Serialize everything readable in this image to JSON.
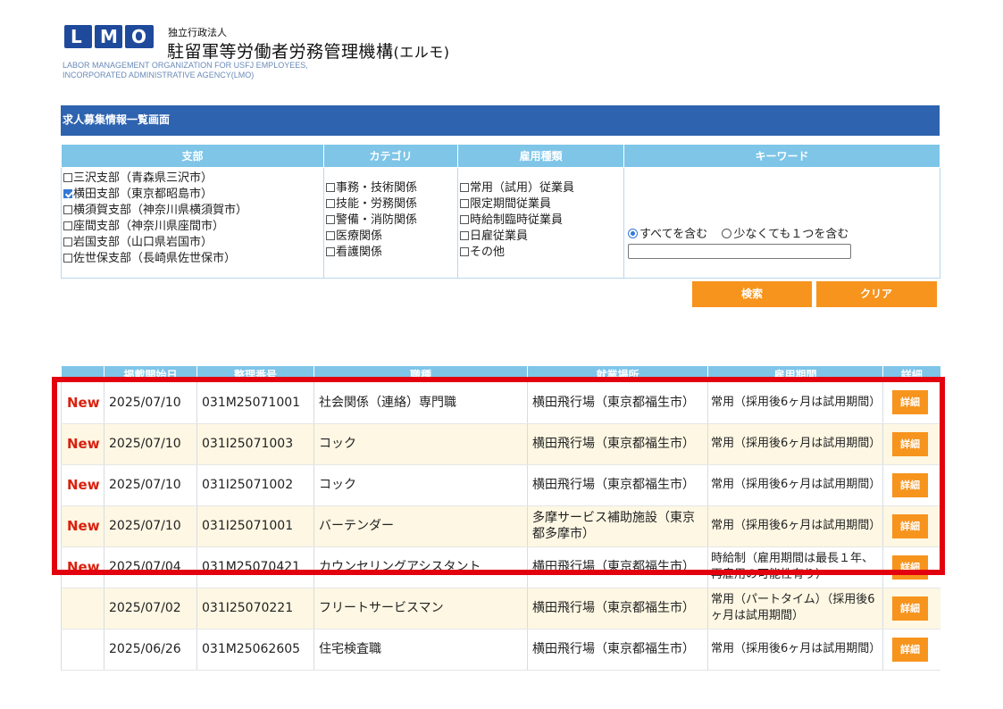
{
  "header": {
    "logo_text": "LMO",
    "org_type": "独立行政法人",
    "org_name": "駐留軍等労働者労務管理機構",
    "org_suffix": "(エルモ)",
    "org_en_line1": "LABOR MANAGEMENT ORGANIZATION FOR USFJ EMPLOYEES,",
    "org_en_line2": "INCORPORATED ADMINISTRATIVE AGENCY(LMO)"
  },
  "page_title": "求人募集情報一覧画面",
  "search": {
    "headers": [
      "支部",
      "カテゴリ",
      "雇用種類",
      "キーワード"
    ],
    "branches": [
      {
        "label": "三沢支部（青森県三沢市）",
        "checked": false
      },
      {
        "label": "横田支部（東京都昭島市）",
        "checked": true
      },
      {
        "label": "横須賀支部（神奈川県横須賀市）",
        "checked": false
      },
      {
        "label": "座間支部（神奈川県座間市）",
        "checked": false
      },
      {
        "label": "岩国支部（山口県岩国市）",
        "checked": false
      },
      {
        "label": "佐世保支部（長崎県佐世保市）",
        "checked": false
      }
    ],
    "categories": [
      {
        "label": "事務・技術関係",
        "checked": false
      },
      {
        "label": "技能・労務関係",
        "checked": false
      },
      {
        "label": "警備・消防関係",
        "checked": false
      },
      {
        "label": "医療関係",
        "checked": false
      },
      {
        "label": "看護関係",
        "checked": false
      }
    ],
    "employment_types": [
      {
        "label": "常用（試用）従業員",
        "checked": false
      },
      {
        "label": "限定期間従業員",
        "checked": false
      },
      {
        "label": "時給制臨時従業員",
        "checked": false
      },
      {
        "label": "日雇従業員",
        "checked": false
      },
      {
        "label": "その他",
        "checked": false
      }
    ],
    "keyword": {
      "mode_all": "すべてを含む",
      "mode_any": "少なくても１つを含む",
      "selected_mode": "all",
      "value": ""
    },
    "search_button": "検索",
    "clear_button": "クリア"
  },
  "results": {
    "headers": [
      "掲載開始日",
      "整理番号",
      "職種",
      "就業場所",
      "雇用期間",
      "詳細"
    ],
    "detail_label": "詳細",
    "rows": [
      {
        "badge": "New",
        "date": "2025/07/10",
        "number": "031M25071001",
        "job": "社会関係（連絡）専門職",
        "place": "横田飛行場（東京都福生市）",
        "period": "常用（採用後6ヶ月は試用期間）"
      },
      {
        "badge": "New",
        "date": "2025/07/10",
        "number": "031I25071003",
        "job": "コック",
        "place": "横田飛行場（東京都福生市）",
        "period": "常用（採用後6ヶ月は試用期間）"
      },
      {
        "badge": "New",
        "date": "2025/07/10",
        "number": "031I25071002",
        "job": "コック",
        "place": "横田飛行場（東京都福生市）",
        "period": "常用（採用後6ヶ月は試用期間）"
      },
      {
        "badge": "New",
        "date": "2025/07/10",
        "number": "031I25071001",
        "job": "バーテンダー",
        "place": "多摩サービス補助施設（東京都多摩市）",
        "period": "常用（採用後6ヶ月は試用期間）"
      },
      {
        "badge": "New",
        "date": "2025/07/04",
        "number": "031M25070421",
        "job": "カウンセリングアシスタント",
        "place": "横田飛行場（東京都福生市）",
        "period": "時給制（雇用期間は最長１年、再雇用の可能性有り）"
      },
      {
        "badge": "",
        "date": "2025/07/02",
        "number": "031I25070221",
        "job": "フリートサービスマン",
        "place": "横田飛行場（東京都福生市）",
        "period": "常用（パートタイム）（採用後6ヶ月は試用期間）"
      },
      {
        "badge": "",
        "date": "2025/06/26",
        "number": "031M25062605",
        "job": "住宅検査職",
        "place": "横田飛行場（東京都福生市）",
        "period": "常用（採用後6ヶ月は試用期間）"
      }
    ]
  },
  "highlight_color": "#e3000f",
  "accent_color": "#f7941d",
  "title_bar_color": "#2e63af"
}
